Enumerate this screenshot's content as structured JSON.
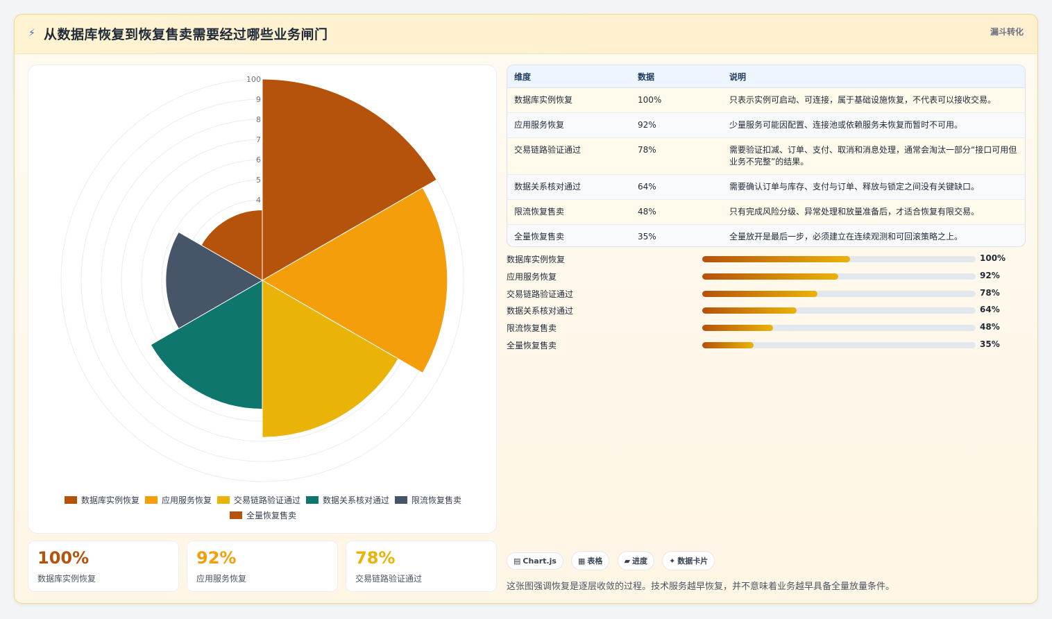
{
  "header": {
    "icon": "lightning-icon",
    "title": "从数据库恢复到恢复售卖需要经过哪些业务闸门",
    "tag": "漏斗转化"
  },
  "chart_data": {
    "type": "polarArea",
    "categories": [
      "数据库实例恢复",
      "应用服务恢复",
      "交易链路验证通过",
      "数据关系核对通过",
      "限流恢复售卖",
      "全量恢复售卖"
    ],
    "values": [
      100,
      92,
      78,
      64,
      48,
      35
    ],
    "colors": [
      "#b5520b",
      "#f59e0b",
      "#eab308",
      "#0f766e",
      "#475569",
      "#b5520b"
    ],
    "radial_ticks": [
      "100",
      "9",
      "8",
      "7",
      "6",
      "5",
      "4"
    ],
    "rlim": [
      0,
      100
    ],
    "grid": true,
    "legend": "bottom"
  },
  "table": {
    "headers": [
      "维度",
      "数据",
      "说明"
    ],
    "rows": [
      {
        "dim": "数据库实例恢复",
        "value": "100%",
        "note": "只表示实例可启动、可连接，属于基础设施恢复，不代表可以接收交易。"
      },
      {
        "dim": "应用服务恢复",
        "value": "92%",
        "note": "少量服务可能因配置、连接池或依赖服务未恢复而暂时不可用。"
      },
      {
        "dim": "交易链路验证通过",
        "value": "78%",
        "note": "需要验证扣减、订单、支付、取消和消息处理，通常会淘汰一部分“接口可用但业务不完整”的结果。"
      },
      {
        "dim": "数据关系核对通过",
        "value": "64%",
        "note": "需要确认订单与库存、支付与订单、释放与锁定之间没有关键缺口。"
      },
      {
        "dim": "限流恢复售卖",
        "value": "48%",
        "note": "只有完成风险分级、异常处理和放量准备后，才适合恢复有限交易。"
      },
      {
        "dim": "全量恢复售卖",
        "value": "35%",
        "note": "全量放开是最后一步，必须建立在连续观测和可回滚策略之上。"
      }
    ]
  },
  "progress": [
    {
      "label": "数据库实例恢复",
      "value": 100,
      "display": "100%"
    },
    {
      "label": "应用服务恢复",
      "value": 92,
      "display": "92%"
    },
    {
      "label": "交易链路验证通过",
      "value": 78,
      "display": "78%"
    },
    {
      "label": "数据关系核对通过",
      "value": 64,
      "display": "64%"
    },
    {
      "label": "限流恢复售卖",
      "value": 48,
      "display": "48%"
    },
    {
      "label": "全量恢复售卖",
      "value": 35,
      "display": "35%"
    }
  ],
  "stats": [
    {
      "value": "100%",
      "label": "数据库实例恢复",
      "color": "#b5520b"
    },
    {
      "value": "92%",
      "label": "应用服务恢复",
      "color": "#f59e0b"
    },
    {
      "value": "78%",
      "label": "交易链路验证通过",
      "color": "#eab308"
    }
  ],
  "chips": [
    {
      "icon": "chart-icon",
      "glyph": "▤",
      "label": "Chart.js"
    },
    {
      "icon": "table-icon",
      "glyph": "▦",
      "label": "表格"
    },
    {
      "icon": "progress-icon",
      "glyph": "▰",
      "label": "进度"
    },
    {
      "icon": "sparkle-icon",
      "glyph": "✦",
      "label": "数据卡片"
    }
  ],
  "footnote": "这张图强调恢复是逐层收敛的过程。技术服务越早恢复，并不意味着业务越早具备全量放量条件。"
}
